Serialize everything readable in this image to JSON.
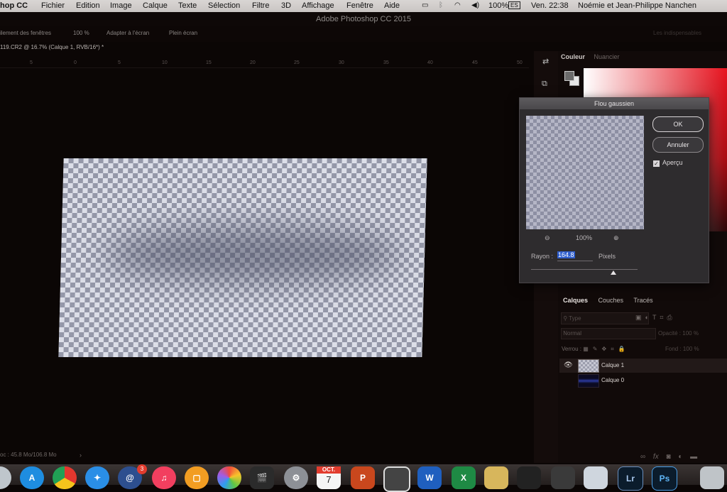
{
  "menubar": {
    "app_name": "hop CC",
    "items": [
      "Fichier",
      "Edition",
      "Image",
      "Calque",
      "Texte",
      "Sélection",
      "Filtre",
      "3D",
      "Affichage",
      "Fenêtre",
      "Aide"
    ],
    "battery": "100%",
    "clock": "Ven. 22:38",
    "user": "Noémie et Jean-Philippe Nanchen",
    "input_source": "ES"
  },
  "window": {
    "title": "Adobe Photoshop CC 2015"
  },
  "options_bar": {
    "items": [
      "ilement des fenêtres",
      "100 %",
      "Adapter à l'écran",
      "Plein écran"
    ],
    "workspace": "Les indispensables"
  },
  "document": {
    "tab_title": "119.CR2 @ 16.7% (Calque 1, RVB/16*) *",
    "ruler_ticks": [
      "5",
      "0",
      "5",
      "10",
      "15",
      "20",
      "25",
      "30",
      "35",
      "40",
      "45",
      "50"
    ],
    "status": "oc : 45.8 Mo/106.8 Mo"
  },
  "color_panel": {
    "tabs": [
      "Couleur",
      "Nuancier"
    ],
    "foreground": "#6b6b6b",
    "background": "#e7e7e7",
    "hue": "#e81420"
  },
  "gaussian_blur_dialog": {
    "title": "Flou gaussien",
    "ok_label": "OK",
    "cancel_label": "Annuler",
    "preview_label": "Aperçu",
    "preview_checked": true,
    "zoom_out_icon": "⊖",
    "zoom_level": "100%",
    "zoom_in_icon": "⊕",
    "radius_label": "Rayon :",
    "radius_value": "164.8",
    "radius_unit": "Pixels"
  },
  "layers_panel": {
    "tabs": [
      "Calques",
      "Couches",
      "Tracés"
    ],
    "filter_placeholder": "Type",
    "blend_mode": "Normal",
    "opacity_label": "Opacité :",
    "opacity_value": "100 %",
    "lock_label": "Verrou :",
    "fill_label": "Fond :",
    "fill_value": "100 %",
    "layers": [
      {
        "name": "Calque 1",
        "visible": true,
        "selected": true
      },
      {
        "name": "Calque 0",
        "visible": false,
        "selected": false
      }
    ],
    "bottom_icons": [
      "link-icon",
      "fx-icon",
      "mask-icon",
      "adjustment-icon",
      "folder-icon"
    ]
  },
  "dock": {
    "calendar_month": "OCT.",
    "calendar_day": "7",
    "mail_badge": "3",
    "lr_label": "Lr",
    "ps_label": "Ps"
  }
}
